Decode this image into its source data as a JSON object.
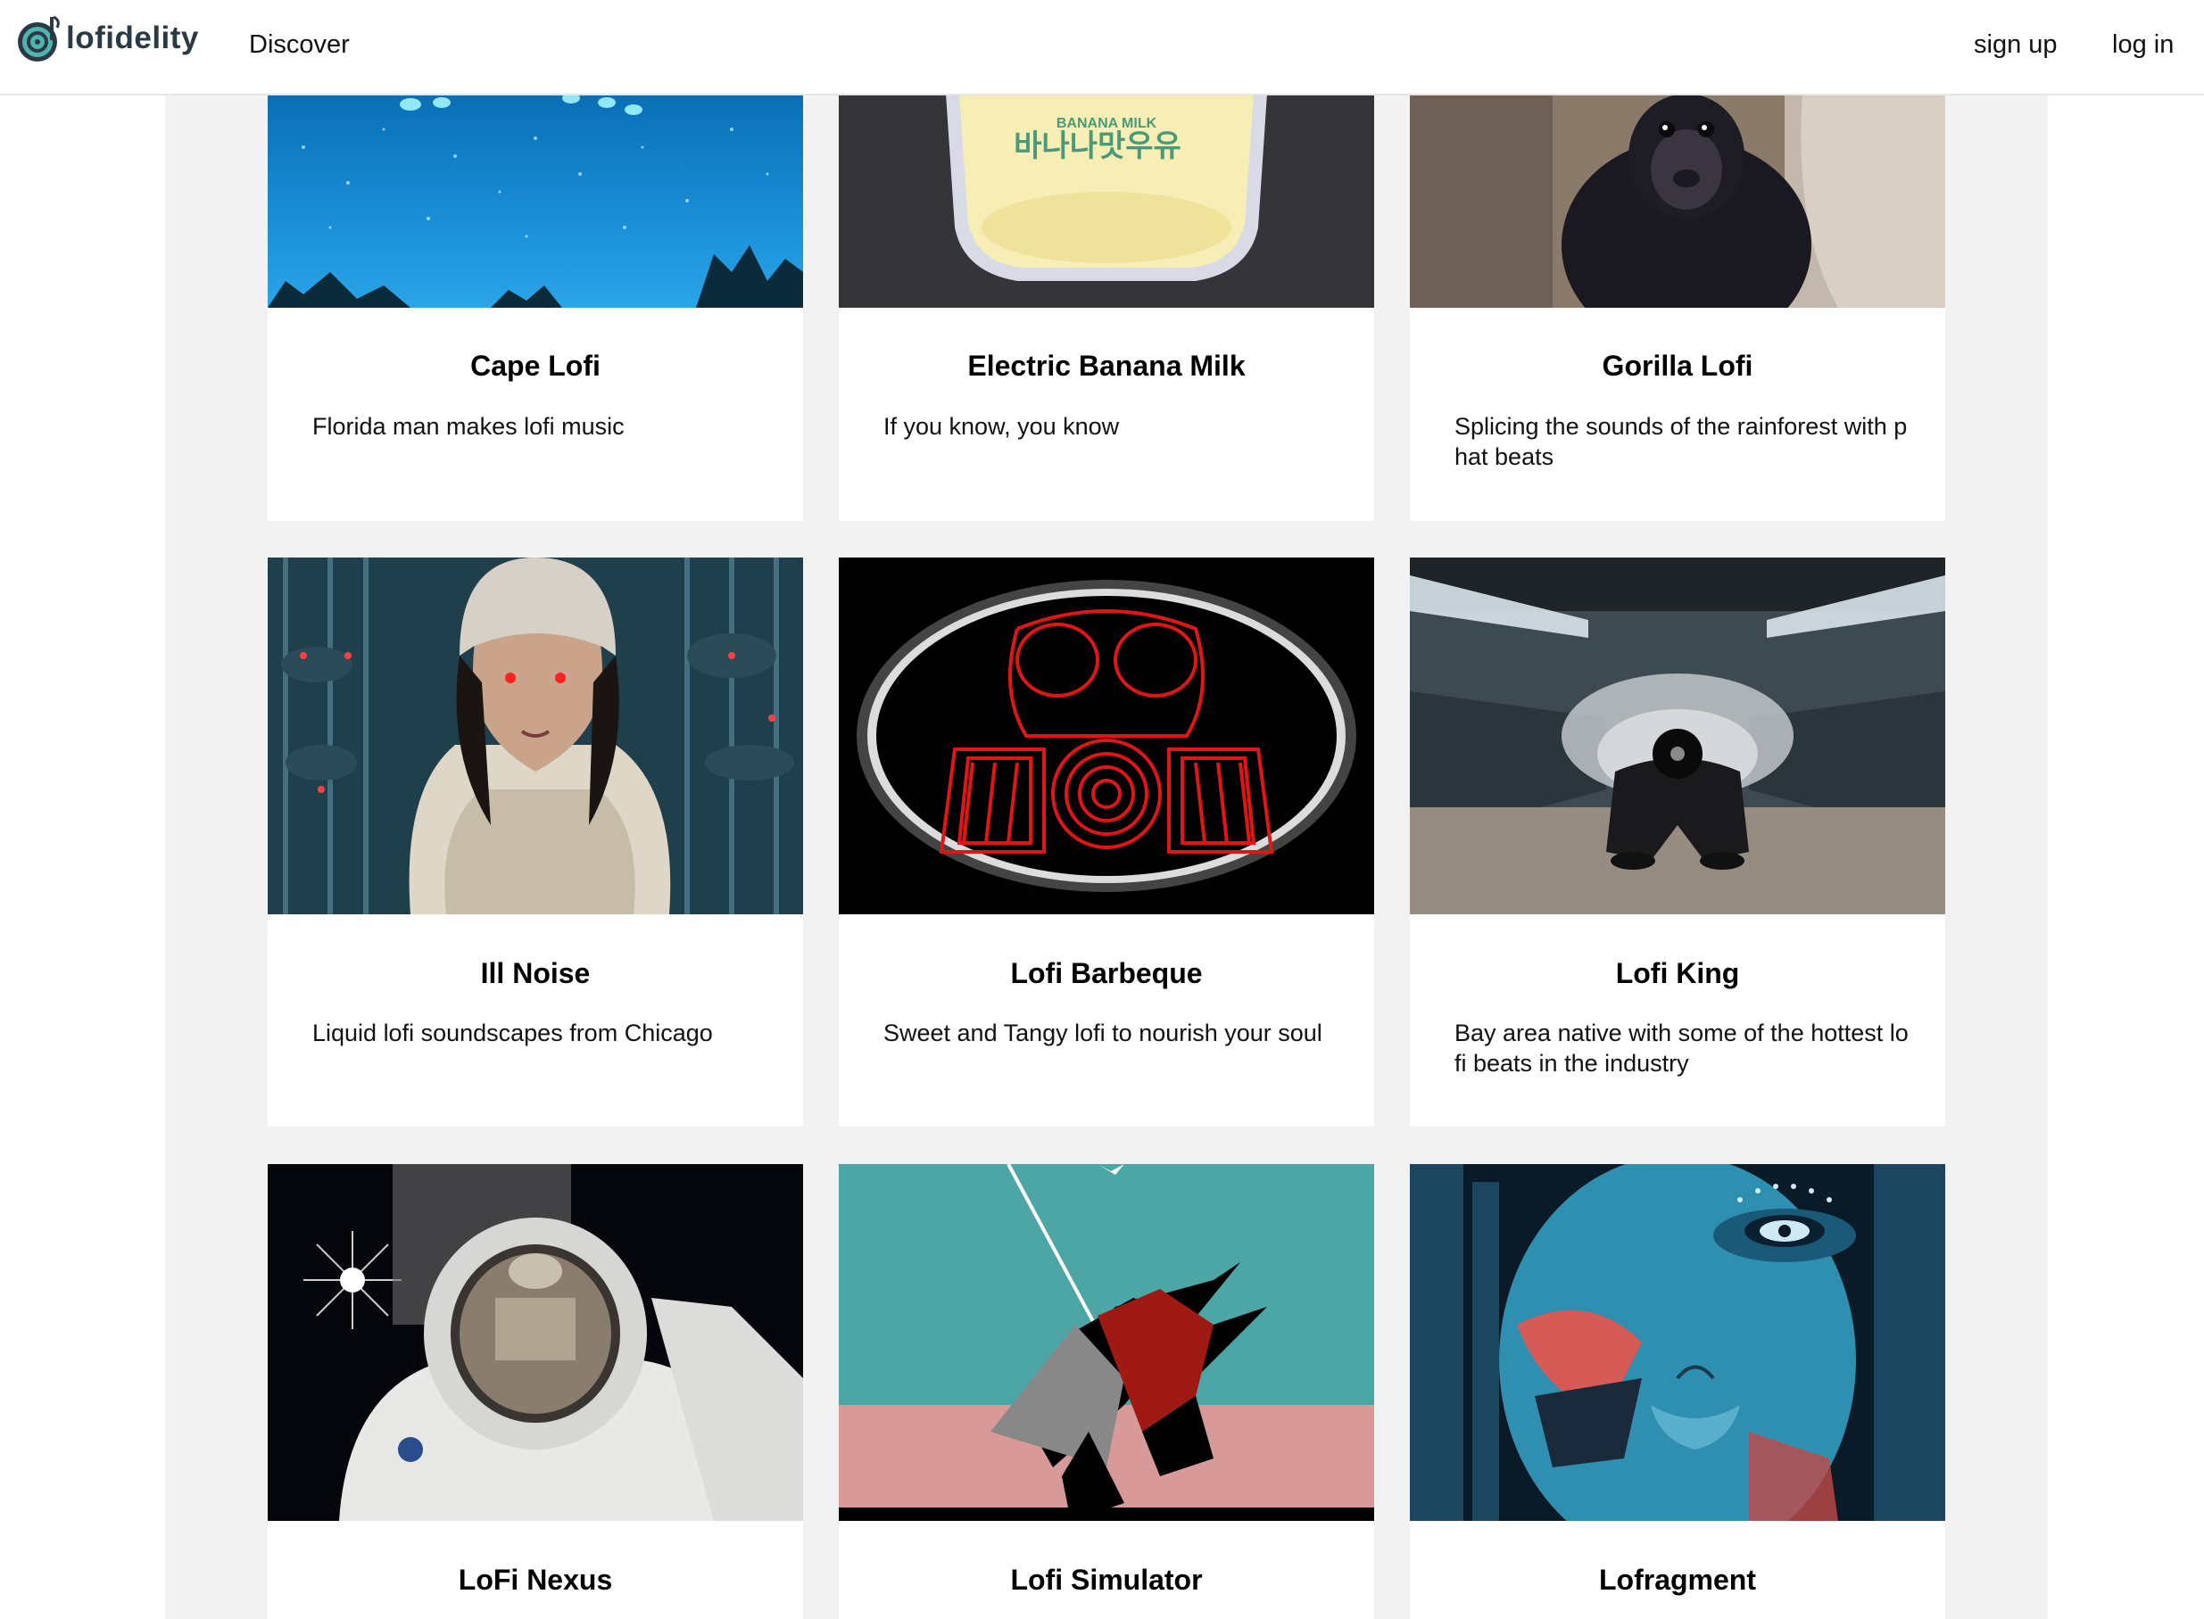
{
  "nav": {
    "logo_text": "lofidelity",
    "discover": "Discover",
    "sign_up": "sign up",
    "log_in": "log in"
  },
  "cards": [
    {
      "title": "Cape Lofi",
      "description": "Florida man makes lofi music",
      "image": "night-sky-stars"
    },
    {
      "title": "Electric Banana Milk",
      "description": "If you know, you know",
      "image": "banana-milk-sticker"
    },
    {
      "title": "Gorilla Lofi",
      "description": "Splicing the sounds of the rainforest with phat beats",
      "image": "baby-gorilla"
    },
    {
      "title": "Ill Noise",
      "description": "Liquid lofi soundscapes from Chicago",
      "image": "woman-in-hat-rain"
    },
    {
      "title": "Lofi Barbeque",
      "description": "Sweet and Tangy lofi to nourish your soul",
      "image": "red-gas-mask"
    },
    {
      "title": "Lofi King",
      "description": "Bay area native with some of the hottest lofi beats in the industry",
      "image": "subway-smoke-record"
    },
    {
      "title": "LoFi Nexus",
      "description": "",
      "image": "astronaut"
    },
    {
      "title": "Lofi Simulator",
      "description": "",
      "image": "low-poly-plane"
    },
    {
      "title": "Lofragment",
      "description": "",
      "image": "glitch-face"
    }
  ]
}
